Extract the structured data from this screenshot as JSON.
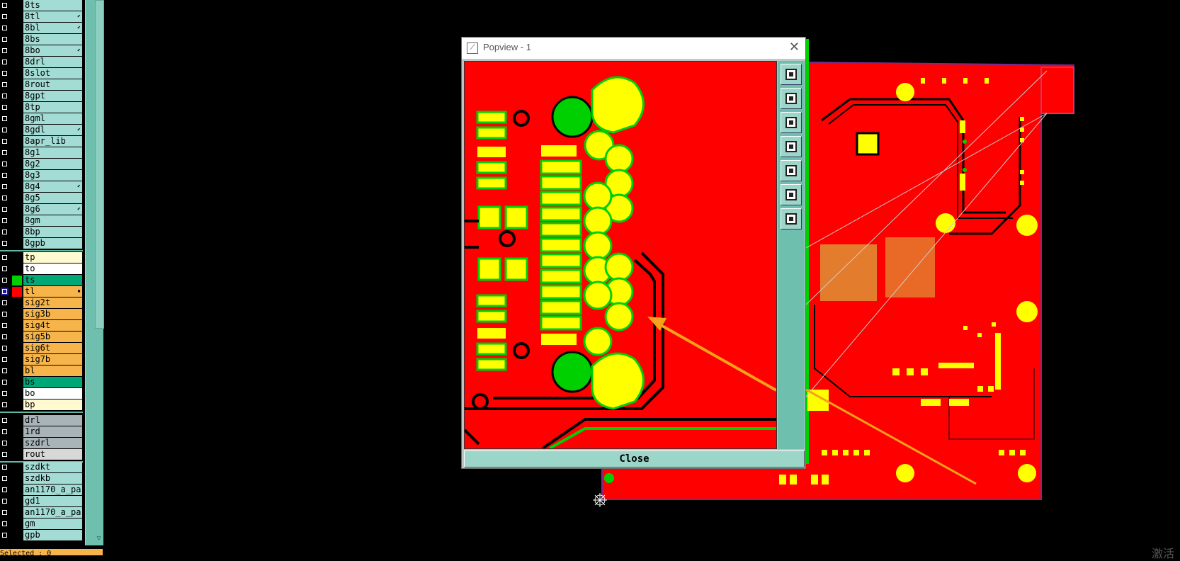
{
  "layers": {
    "group1": [
      {
        "name": "8ts",
        "mark": ""
      },
      {
        "name": "8tl",
        "mark": "⬋"
      },
      {
        "name": "8bl",
        "mark": "⬋"
      },
      {
        "name": "8bs",
        "mark": ""
      },
      {
        "name": "8bo",
        "mark": "⬋"
      },
      {
        "name": "8drl",
        "mark": ""
      },
      {
        "name": "8slot",
        "mark": ""
      },
      {
        "name": "8rout",
        "mark": ""
      },
      {
        "name": "8gpt",
        "mark": ""
      },
      {
        "name": "8tp",
        "mark": ""
      },
      {
        "name": "8gml",
        "mark": ""
      },
      {
        "name": "8gdl",
        "mark": "⬋"
      },
      {
        "name": "8apr_lib",
        "mark": ""
      },
      {
        "name": "8g1",
        "mark": ""
      },
      {
        "name": "8g2",
        "mark": ""
      },
      {
        "name": "8g3",
        "mark": ""
      },
      {
        "name": "8g4",
        "mark": "⬋"
      },
      {
        "name": "8g5",
        "mark": ""
      },
      {
        "name": "8g6",
        "mark": "⬋"
      },
      {
        "name": "8gm",
        "mark": ""
      },
      {
        "name": "8bp",
        "mark": ""
      },
      {
        "name": "8gpb",
        "mark": ""
      }
    ],
    "group2": [
      {
        "name": "tp",
        "bg": "#fffad0",
        "mark": ""
      },
      {
        "name": "to",
        "bg": "#ffffff",
        "mark": ""
      },
      {
        "name": "ts",
        "bg": "#00a878",
        "color": "#00d000",
        "mark": ""
      },
      {
        "name": "tl",
        "bg": "#f6b44a",
        "color": "#ff0000",
        "mark": "▪",
        "active": true
      },
      {
        "name": "sig2t",
        "bg": "#f6b44a",
        "mark": ""
      },
      {
        "name": "sig3b",
        "bg": "#f6b44a",
        "mark": ""
      },
      {
        "name": "sig4t",
        "bg": "#f6b44a",
        "mark": ""
      },
      {
        "name": "sig5b",
        "bg": "#f6b44a",
        "mark": ""
      },
      {
        "name": "sig6t",
        "bg": "#f6b44a",
        "mark": ""
      },
      {
        "name": "sig7b",
        "bg": "#f6b44a",
        "mark": ""
      },
      {
        "name": "bl",
        "bg": "#f6b44a",
        "mark": ""
      },
      {
        "name": "bs",
        "bg": "#00a878",
        "mark": ""
      },
      {
        "name": "bo",
        "bg": "#ffffff",
        "mark": ""
      },
      {
        "name": "bp",
        "bg": "#fffad0",
        "mark": ""
      }
    ],
    "group3": [
      {
        "name": "drl",
        "bg": "#a9b4b8",
        "mark": ""
      },
      {
        "name": "1rd",
        "bg": "#a9b4b8",
        "mark": ""
      },
      {
        "name": "szdrl",
        "bg": "#a9b4b8",
        "mark": ""
      },
      {
        "name": "rout",
        "bg": "#d8d8d8",
        "mark": ""
      }
    ],
    "group4": [
      {
        "name": "szdkt",
        "mark": ""
      },
      {
        "name": "szdkb",
        "mark": ""
      },
      {
        "name": "an1170_a_pa",
        "mark": ""
      },
      {
        "name": "gd1",
        "mark": ""
      },
      {
        "name": "an1170_a_pa",
        "mark": ""
      },
      {
        "name": "gm",
        "mark": ""
      },
      {
        "name": "gpb",
        "mark": ""
      }
    ],
    "default_bg": "#a3dcd5"
  },
  "status_text": "Selected : 0",
  "popview": {
    "title": "Popview - 1",
    "close_glyph": "✕",
    "close_button": "Close",
    "tools": [
      "zoom-window-icon",
      "pan-up-icon",
      "pan-down-icon",
      "pan-left-icon",
      "pan-right-icon",
      "zoom-fit-icon",
      "zoom-out-icon"
    ]
  },
  "watermark": "激活",
  "colors": {
    "copper": "#ff0000",
    "pad": "#ffff00",
    "silk": "#00d000",
    "trace": "#000000",
    "panel": "#a3dcd5",
    "arrow": "#f6a21a"
  }
}
